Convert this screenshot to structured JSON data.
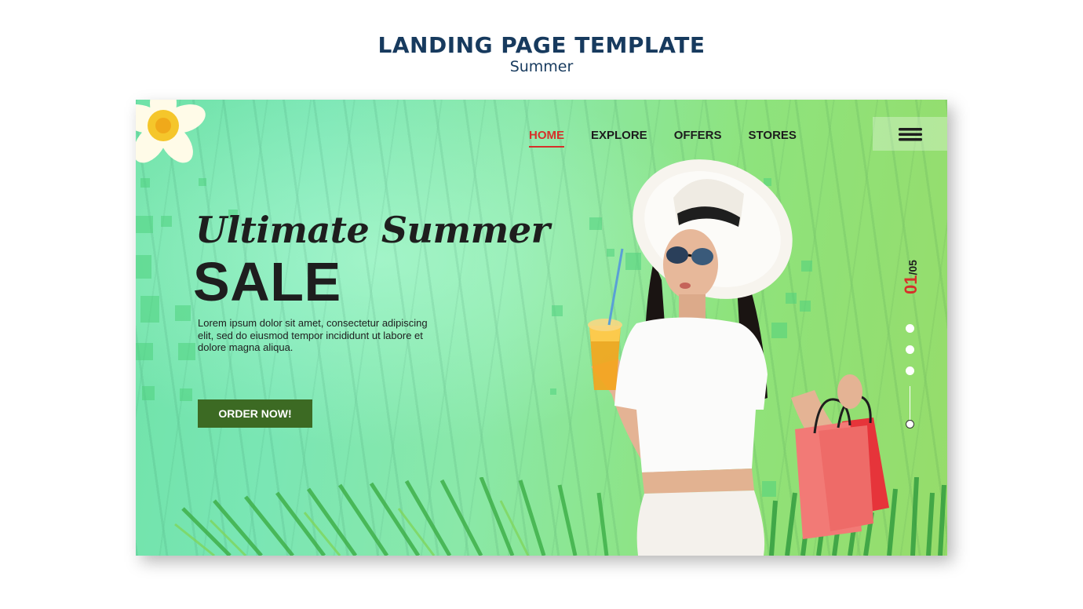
{
  "page": {
    "title": "LANDING PAGE TEMPLATE",
    "subtitle": "Summer"
  },
  "nav": {
    "items": [
      {
        "label": "HOME",
        "active": true
      },
      {
        "label": "EXPLORE",
        "active": false
      },
      {
        "label": "OFFERS",
        "active": false
      },
      {
        "label": "STORES",
        "active": false
      }
    ],
    "menu_icon": "hamburger-icon"
  },
  "hero": {
    "headline": "Ultimate Summer",
    "sale": "SALE",
    "body": "Lorem ipsum dolor sit amet, consectetur adipiscing elit, sed do eiusmod tempor incididunt ut labore et dolore magna aliqua.",
    "cta_label": "ORDER NOW!"
  },
  "slider": {
    "current": "01",
    "separator": "/",
    "total": "05"
  },
  "colors": {
    "title": "#173a5e",
    "accent_red": "#d6302a",
    "cta_green": "#3c6a23",
    "banner_green": "#7ae6b4"
  }
}
